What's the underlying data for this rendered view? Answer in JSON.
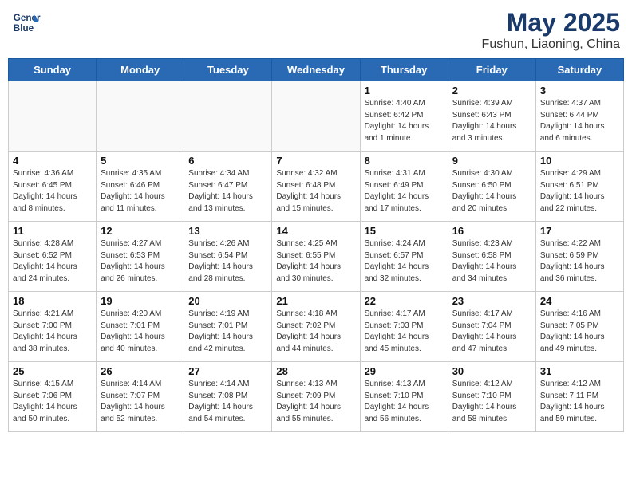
{
  "header": {
    "logo_line1": "General",
    "logo_line2": "Blue",
    "month_title": "May 2025",
    "subtitle": "Fushun, Liaoning, China"
  },
  "weekdays": [
    "Sunday",
    "Monday",
    "Tuesday",
    "Wednesday",
    "Thursday",
    "Friday",
    "Saturday"
  ],
  "weeks": [
    [
      {
        "day": "",
        "info": ""
      },
      {
        "day": "",
        "info": ""
      },
      {
        "day": "",
        "info": ""
      },
      {
        "day": "",
        "info": ""
      },
      {
        "day": "1",
        "info": "Sunrise: 4:40 AM\nSunset: 6:42 PM\nDaylight: 14 hours\nand 1 minute."
      },
      {
        "day": "2",
        "info": "Sunrise: 4:39 AM\nSunset: 6:43 PM\nDaylight: 14 hours\nand 3 minutes."
      },
      {
        "day": "3",
        "info": "Sunrise: 4:37 AM\nSunset: 6:44 PM\nDaylight: 14 hours\nand 6 minutes."
      }
    ],
    [
      {
        "day": "4",
        "info": "Sunrise: 4:36 AM\nSunset: 6:45 PM\nDaylight: 14 hours\nand 8 minutes."
      },
      {
        "day": "5",
        "info": "Sunrise: 4:35 AM\nSunset: 6:46 PM\nDaylight: 14 hours\nand 11 minutes."
      },
      {
        "day": "6",
        "info": "Sunrise: 4:34 AM\nSunset: 6:47 PM\nDaylight: 14 hours\nand 13 minutes."
      },
      {
        "day": "7",
        "info": "Sunrise: 4:32 AM\nSunset: 6:48 PM\nDaylight: 14 hours\nand 15 minutes."
      },
      {
        "day": "8",
        "info": "Sunrise: 4:31 AM\nSunset: 6:49 PM\nDaylight: 14 hours\nand 17 minutes."
      },
      {
        "day": "9",
        "info": "Sunrise: 4:30 AM\nSunset: 6:50 PM\nDaylight: 14 hours\nand 20 minutes."
      },
      {
        "day": "10",
        "info": "Sunrise: 4:29 AM\nSunset: 6:51 PM\nDaylight: 14 hours\nand 22 minutes."
      }
    ],
    [
      {
        "day": "11",
        "info": "Sunrise: 4:28 AM\nSunset: 6:52 PM\nDaylight: 14 hours\nand 24 minutes."
      },
      {
        "day": "12",
        "info": "Sunrise: 4:27 AM\nSunset: 6:53 PM\nDaylight: 14 hours\nand 26 minutes."
      },
      {
        "day": "13",
        "info": "Sunrise: 4:26 AM\nSunset: 6:54 PM\nDaylight: 14 hours\nand 28 minutes."
      },
      {
        "day": "14",
        "info": "Sunrise: 4:25 AM\nSunset: 6:55 PM\nDaylight: 14 hours\nand 30 minutes."
      },
      {
        "day": "15",
        "info": "Sunrise: 4:24 AM\nSunset: 6:57 PM\nDaylight: 14 hours\nand 32 minutes."
      },
      {
        "day": "16",
        "info": "Sunrise: 4:23 AM\nSunset: 6:58 PM\nDaylight: 14 hours\nand 34 minutes."
      },
      {
        "day": "17",
        "info": "Sunrise: 4:22 AM\nSunset: 6:59 PM\nDaylight: 14 hours\nand 36 minutes."
      }
    ],
    [
      {
        "day": "18",
        "info": "Sunrise: 4:21 AM\nSunset: 7:00 PM\nDaylight: 14 hours\nand 38 minutes."
      },
      {
        "day": "19",
        "info": "Sunrise: 4:20 AM\nSunset: 7:01 PM\nDaylight: 14 hours\nand 40 minutes."
      },
      {
        "day": "20",
        "info": "Sunrise: 4:19 AM\nSunset: 7:01 PM\nDaylight: 14 hours\nand 42 minutes."
      },
      {
        "day": "21",
        "info": "Sunrise: 4:18 AM\nSunset: 7:02 PM\nDaylight: 14 hours\nand 44 minutes."
      },
      {
        "day": "22",
        "info": "Sunrise: 4:17 AM\nSunset: 7:03 PM\nDaylight: 14 hours\nand 45 minutes."
      },
      {
        "day": "23",
        "info": "Sunrise: 4:17 AM\nSunset: 7:04 PM\nDaylight: 14 hours\nand 47 minutes."
      },
      {
        "day": "24",
        "info": "Sunrise: 4:16 AM\nSunset: 7:05 PM\nDaylight: 14 hours\nand 49 minutes."
      }
    ],
    [
      {
        "day": "25",
        "info": "Sunrise: 4:15 AM\nSunset: 7:06 PM\nDaylight: 14 hours\nand 50 minutes."
      },
      {
        "day": "26",
        "info": "Sunrise: 4:14 AM\nSunset: 7:07 PM\nDaylight: 14 hours\nand 52 minutes."
      },
      {
        "day": "27",
        "info": "Sunrise: 4:14 AM\nSunset: 7:08 PM\nDaylight: 14 hours\nand 54 minutes."
      },
      {
        "day": "28",
        "info": "Sunrise: 4:13 AM\nSunset: 7:09 PM\nDaylight: 14 hours\nand 55 minutes."
      },
      {
        "day": "29",
        "info": "Sunrise: 4:13 AM\nSunset: 7:10 PM\nDaylight: 14 hours\nand 56 minutes."
      },
      {
        "day": "30",
        "info": "Sunrise: 4:12 AM\nSunset: 7:10 PM\nDaylight: 14 hours\nand 58 minutes."
      },
      {
        "day": "31",
        "info": "Sunrise: 4:12 AM\nSunset: 7:11 PM\nDaylight: 14 hours\nand 59 minutes."
      }
    ]
  ]
}
